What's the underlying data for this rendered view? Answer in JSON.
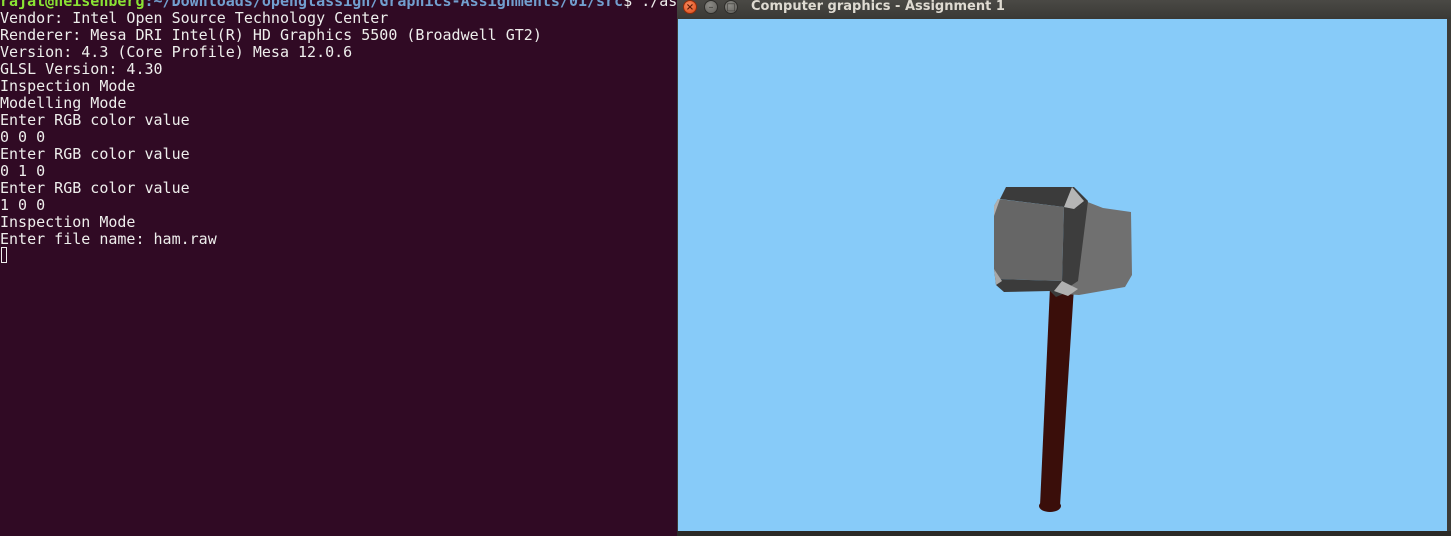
{
  "terminal": {
    "prompt": {
      "user_host": "rajat@heisenberg",
      "path": ":~/Downloads/openglassign/Graphics-Assignments/01/src",
      "symbol": "$",
      "command": " ./ass"
    },
    "lines": [
      "Vendor: Intel Open Source Technology Center",
      "Renderer: Mesa DRI Intel(R) HD Graphics 5500 (Broadwell GT2)",
      "Version: 4.3 (Core Profile) Mesa 12.0.6",
      "GLSL Version: 4.30",
      "Inspection Mode",
      "Modelling Mode",
      "Enter RGB color value",
      "0 0 0",
      "Enter RGB color value",
      "0 1 0",
      "Enter RGB color value",
      "1 0 0",
      "Inspection Mode",
      "Enter file name: ham.raw"
    ]
  },
  "gl_window": {
    "title": "Computer graphics - Assignment 1",
    "close_glyph": "×",
    "min_glyph": "–",
    "max_glyph": "□",
    "scene": {
      "object": "hammer",
      "background_color": "#87cbf9",
      "head_color": "#666666",
      "handle_color": "#3a0e0a"
    }
  }
}
